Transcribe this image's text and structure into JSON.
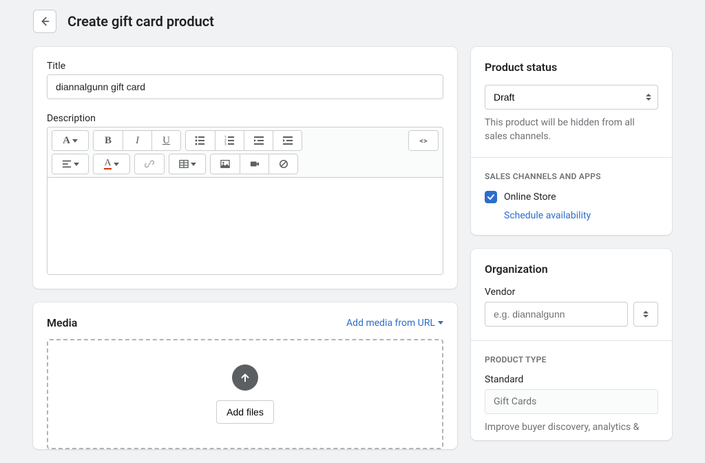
{
  "header": {
    "title": "Create gift card product"
  },
  "main": {
    "title_label": "Title",
    "title_value": "diannalgunn gift card",
    "description_label": "Description",
    "media_heading": "Media",
    "add_media_url": "Add media from URL",
    "add_files": "Add files"
  },
  "status": {
    "heading": "Product status",
    "value": "Draft",
    "help": "This product will be hidden from all sales channels.",
    "channels_heading": "Sales Channels and Apps",
    "online_store": "Online Store",
    "schedule": "Schedule availability"
  },
  "org": {
    "heading": "Organization",
    "vendor_label": "Vendor",
    "vendor_placeholder": "e.g. diannalgunn",
    "product_type_heading": "Product Type",
    "standard_label": "Standard",
    "standard_value": "Gift Cards",
    "type_help": "Improve buyer discovery, analytics &"
  }
}
